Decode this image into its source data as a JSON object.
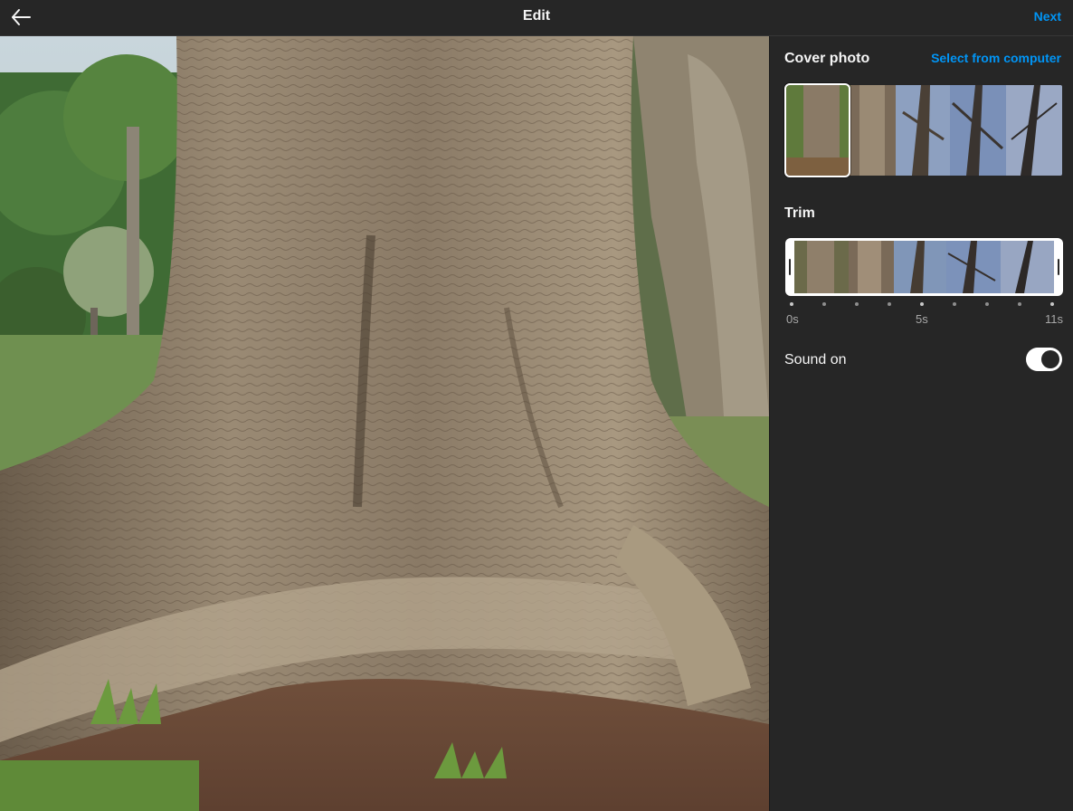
{
  "header": {
    "back_icon": "arrow-left-icon",
    "title": "Edit",
    "next_label": "Next"
  },
  "media": {
    "description_icon": "photo-preview"
  },
  "panel": {
    "cover": {
      "title": "Cover photo",
      "select_label": "Select from computer",
      "selected_index": 0
    },
    "trim": {
      "title": "Trim",
      "labels": [
        "0s",
        "5s",
        "11s"
      ]
    },
    "sound": {
      "label": "Sound on",
      "enabled": true
    }
  },
  "colors": {
    "accent": "#0095f6",
    "background": "#262626",
    "text": "#f5f5f5",
    "muted": "#a8a8a8"
  }
}
